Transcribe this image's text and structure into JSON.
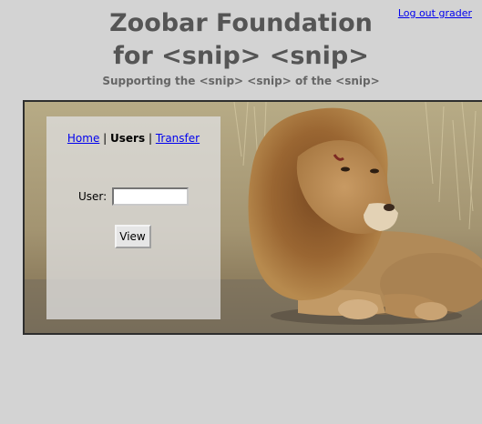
{
  "header": {
    "logout_label": "Log out grader",
    "title_line1": "Zoobar Foundation",
    "title_line2": "for <snip> <snip>",
    "subtitle": "Supporting the <snip> <snip> of the <snip>"
  },
  "nav": {
    "home_label": "Home",
    "users_label": "Users",
    "transfer_label": "Transfer",
    "separator": "|"
  },
  "form": {
    "user_label": "User:",
    "user_value": "",
    "view_label": "View"
  },
  "background_image": "lion-photo"
}
